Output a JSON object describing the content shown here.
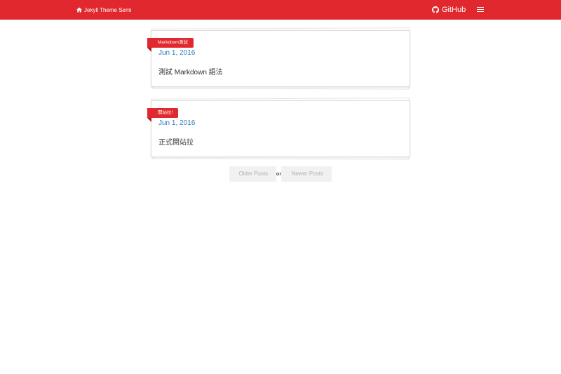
{
  "header": {
    "brand_label": "Jekyll Theme Semi",
    "github_label": "GitHub",
    "brand_color": "#e0282e"
  },
  "posts": [
    {
      "tag": "Markdown測試",
      "date": "Jun 1, 2016",
      "title": "測試 Markdown 語法"
    },
    {
      "tag": "開站拉!",
      "date": "Jun 1, 2016",
      "title": "正式開站拉"
    }
  ],
  "pager": {
    "older_label": "Older Posts",
    "or_label": "or",
    "newer_label": "Newer Posts"
  },
  "icons": {
    "brand": "home-icon",
    "github": "github-icon",
    "menu": "hamburger-menu-icon"
  }
}
